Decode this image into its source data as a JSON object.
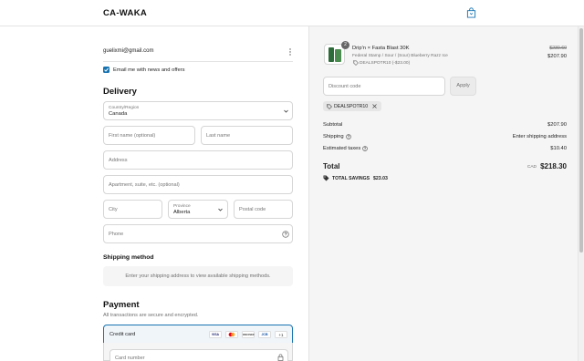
{
  "header": {
    "brand": "CA-WAKA"
  },
  "contact": {
    "email": "guelixmi@gmail.com",
    "newsletter_label": "Email me with news and offers"
  },
  "delivery": {
    "title": "Delivery",
    "country_label": "Country/Region",
    "country_value": "Canada",
    "first_name_placeholder": "First name (optional)",
    "last_name_placeholder": "Last name",
    "address_placeholder": "Address",
    "apartment_placeholder": "Apartment, suite, etc. (optional)",
    "city_placeholder": "City",
    "province_label": "Province",
    "province_value": "Alberta",
    "postal_placeholder": "Postal code",
    "phone_placeholder": "Phone"
  },
  "shipping_method": {
    "title": "Shipping method",
    "message": "Enter your shipping address to view available shipping methods."
  },
  "payment": {
    "title": "Payment",
    "subtitle": "All transactions are secure and encrypted.",
    "credit_card_label": "Credit card",
    "cards": [
      "VISA",
      "",
      "DISCOVER",
      "JCB"
    ],
    "more_cards": "+1",
    "card_number_placeholder": "Card number"
  },
  "summary": {
    "item": {
      "qty": "2",
      "name": "Drip'n × Fasta Blast 30K",
      "variant": "Federal Stamp / Sour / (Sour) Blueberry Razz Ice",
      "discount_tag": "DEALSPOTR10 (-$23.00)",
      "original_price": "$230.60",
      "price": "$207.90"
    },
    "discount_placeholder": "Discount code",
    "apply_label": "Apply",
    "applied_code": "DEALSPOTR10",
    "subtotal_label": "Subtotal",
    "subtotal_value": "$207.90",
    "shipping_label": "Shipping",
    "shipping_value": "Enter shipping address",
    "taxes_label": "Estimated taxes",
    "taxes_value": "$10.40",
    "total_label": "Total",
    "currency": "CAD",
    "total_value": "$218.30",
    "savings_label": "TOTAL SAVINGS",
    "savings_value": "$23.03"
  },
  "colors": {
    "accent": "#1773b0",
    "checkbox": "#1773b0",
    "field_border": "#d6d6d6"
  }
}
